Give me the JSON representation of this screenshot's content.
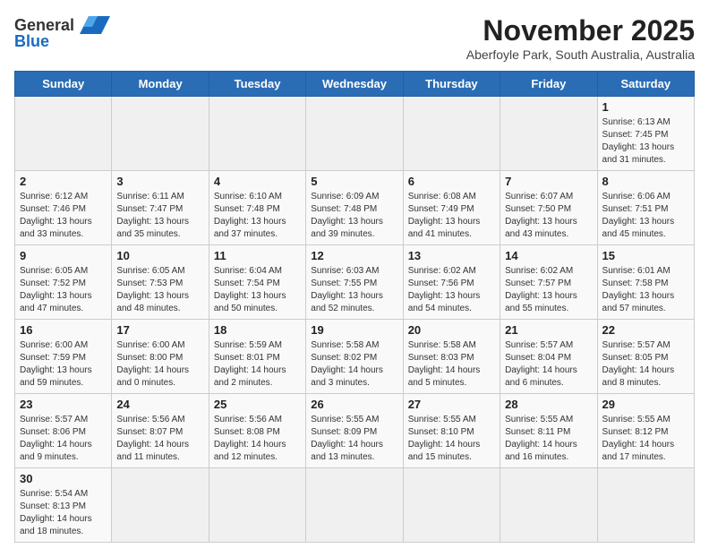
{
  "header": {
    "logo_general": "General",
    "logo_blue": "Blue",
    "month_title": "November 2025",
    "location": "Aberfoyle Park, South Australia, Australia"
  },
  "weekdays": [
    "Sunday",
    "Monday",
    "Tuesday",
    "Wednesday",
    "Thursday",
    "Friday",
    "Saturday"
  ],
  "days": [
    {
      "num": "",
      "sunrise": "",
      "sunset": "",
      "daylight": "",
      "empty": true
    },
    {
      "num": "",
      "sunrise": "",
      "sunset": "",
      "daylight": "",
      "empty": true
    },
    {
      "num": "",
      "sunrise": "",
      "sunset": "",
      "daylight": "",
      "empty": true
    },
    {
      "num": "",
      "sunrise": "",
      "sunset": "",
      "daylight": "",
      "empty": true
    },
    {
      "num": "",
      "sunrise": "",
      "sunset": "",
      "daylight": "",
      "empty": true
    },
    {
      "num": "",
      "sunrise": "",
      "sunset": "",
      "daylight": "",
      "empty": true
    },
    {
      "num": "1",
      "sunrise": "Sunrise: 6:13 AM",
      "sunset": "Sunset: 7:45 PM",
      "daylight": "Daylight: 13 hours and 31 minutes.",
      "empty": false
    },
    {
      "num": "2",
      "sunrise": "Sunrise: 6:12 AM",
      "sunset": "Sunset: 7:46 PM",
      "daylight": "Daylight: 13 hours and 33 minutes.",
      "empty": false
    },
    {
      "num": "3",
      "sunrise": "Sunrise: 6:11 AM",
      "sunset": "Sunset: 7:47 PM",
      "daylight": "Daylight: 13 hours and 35 minutes.",
      "empty": false
    },
    {
      "num": "4",
      "sunrise": "Sunrise: 6:10 AM",
      "sunset": "Sunset: 7:48 PM",
      "daylight": "Daylight: 13 hours and 37 minutes.",
      "empty": false
    },
    {
      "num": "5",
      "sunrise": "Sunrise: 6:09 AM",
      "sunset": "Sunset: 7:48 PM",
      "daylight": "Daylight: 13 hours and 39 minutes.",
      "empty": false
    },
    {
      "num": "6",
      "sunrise": "Sunrise: 6:08 AM",
      "sunset": "Sunset: 7:49 PM",
      "daylight": "Daylight: 13 hours and 41 minutes.",
      "empty": false
    },
    {
      "num": "7",
      "sunrise": "Sunrise: 6:07 AM",
      "sunset": "Sunset: 7:50 PM",
      "daylight": "Daylight: 13 hours and 43 minutes.",
      "empty": false
    },
    {
      "num": "8",
      "sunrise": "Sunrise: 6:06 AM",
      "sunset": "Sunset: 7:51 PM",
      "daylight": "Daylight: 13 hours and 45 minutes.",
      "empty": false
    },
    {
      "num": "9",
      "sunrise": "Sunrise: 6:05 AM",
      "sunset": "Sunset: 7:52 PM",
      "daylight": "Daylight: 13 hours and 47 minutes.",
      "empty": false
    },
    {
      "num": "10",
      "sunrise": "Sunrise: 6:05 AM",
      "sunset": "Sunset: 7:53 PM",
      "daylight": "Daylight: 13 hours and 48 minutes.",
      "empty": false
    },
    {
      "num": "11",
      "sunrise": "Sunrise: 6:04 AM",
      "sunset": "Sunset: 7:54 PM",
      "daylight": "Daylight: 13 hours and 50 minutes.",
      "empty": false
    },
    {
      "num": "12",
      "sunrise": "Sunrise: 6:03 AM",
      "sunset": "Sunset: 7:55 PM",
      "daylight": "Daylight: 13 hours and 52 minutes.",
      "empty": false
    },
    {
      "num": "13",
      "sunrise": "Sunrise: 6:02 AM",
      "sunset": "Sunset: 7:56 PM",
      "daylight": "Daylight: 13 hours and 54 minutes.",
      "empty": false
    },
    {
      "num": "14",
      "sunrise": "Sunrise: 6:02 AM",
      "sunset": "Sunset: 7:57 PM",
      "daylight": "Daylight: 13 hours and 55 minutes.",
      "empty": false
    },
    {
      "num": "15",
      "sunrise": "Sunrise: 6:01 AM",
      "sunset": "Sunset: 7:58 PM",
      "daylight": "Daylight: 13 hours and 57 minutes.",
      "empty": false
    },
    {
      "num": "16",
      "sunrise": "Sunrise: 6:00 AM",
      "sunset": "Sunset: 7:59 PM",
      "daylight": "Daylight: 13 hours and 59 minutes.",
      "empty": false
    },
    {
      "num": "17",
      "sunrise": "Sunrise: 6:00 AM",
      "sunset": "Sunset: 8:00 PM",
      "daylight": "Daylight: 14 hours and 0 minutes.",
      "empty": false
    },
    {
      "num": "18",
      "sunrise": "Sunrise: 5:59 AM",
      "sunset": "Sunset: 8:01 PM",
      "daylight": "Daylight: 14 hours and 2 minutes.",
      "empty": false
    },
    {
      "num": "19",
      "sunrise": "Sunrise: 5:58 AM",
      "sunset": "Sunset: 8:02 PM",
      "daylight": "Daylight: 14 hours and 3 minutes.",
      "empty": false
    },
    {
      "num": "20",
      "sunrise": "Sunrise: 5:58 AM",
      "sunset": "Sunset: 8:03 PM",
      "daylight": "Daylight: 14 hours and 5 minutes.",
      "empty": false
    },
    {
      "num": "21",
      "sunrise": "Sunrise: 5:57 AM",
      "sunset": "Sunset: 8:04 PM",
      "daylight": "Daylight: 14 hours and 6 minutes.",
      "empty": false
    },
    {
      "num": "22",
      "sunrise": "Sunrise: 5:57 AM",
      "sunset": "Sunset: 8:05 PM",
      "daylight": "Daylight: 14 hours and 8 minutes.",
      "empty": false
    },
    {
      "num": "23",
      "sunrise": "Sunrise: 5:57 AM",
      "sunset": "Sunset: 8:06 PM",
      "daylight": "Daylight: 14 hours and 9 minutes.",
      "empty": false
    },
    {
      "num": "24",
      "sunrise": "Sunrise: 5:56 AM",
      "sunset": "Sunset: 8:07 PM",
      "daylight": "Daylight: 14 hours and 11 minutes.",
      "empty": false
    },
    {
      "num": "25",
      "sunrise": "Sunrise: 5:56 AM",
      "sunset": "Sunset: 8:08 PM",
      "daylight": "Daylight: 14 hours and 12 minutes.",
      "empty": false
    },
    {
      "num": "26",
      "sunrise": "Sunrise: 5:55 AM",
      "sunset": "Sunset: 8:09 PM",
      "daylight": "Daylight: 14 hours and 13 minutes.",
      "empty": false
    },
    {
      "num": "27",
      "sunrise": "Sunrise: 5:55 AM",
      "sunset": "Sunset: 8:10 PM",
      "daylight": "Daylight: 14 hours and 15 minutes.",
      "empty": false
    },
    {
      "num": "28",
      "sunrise": "Sunrise: 5:55 AM",
      "sunset": "Sunset: 8:11 PM",
      "daylight": "Daylight: 14 hours and 16 minutes.",
      "empty": false
    },
    {
      "num": "29",
      "sunrise": "Sunrise: 5:55 AM",
      "sunset": "Sunset: 8:12 PM",
      "daylight": "Daylight: 14 hours and 17 minutes.",
      "empty": false
    },
    {
      "num": "30",
      "sunrise": "Sunrise: 5:54 AM",
      "sunset": "Sunset: 8:13 PM",
      "daylight": "Daylight: 14 hours and 18 minutes.",
      "empty": false
    },
    {
      "num": "",
      "sunrise": "",
      "sunset": "",
      "daylight": "",
      "empty": true
    },
    {
      "num": "",
      "sunrise": "",
      "sunset": "",
      "daylight": "",
      "empty": true
    },
    {
      "num": "",
      "sunrise": "",
      "sunset": "",
      "daylight": "",
      "empty": true
    },
    {
      "num": "",
      "sunrise": "",
      "sunset": "",
      "daylight": "",
      "empty": true
    },
    {
      "num": "",
      "sunrise": "",
      "sunset": "",
      "daylight": "",
      "empty": true
    },
    {
      "num": "",
      "sunrise": "",
      "sunset": "",
      "daylight": "",
      "empty": true
    }
  ]
}
